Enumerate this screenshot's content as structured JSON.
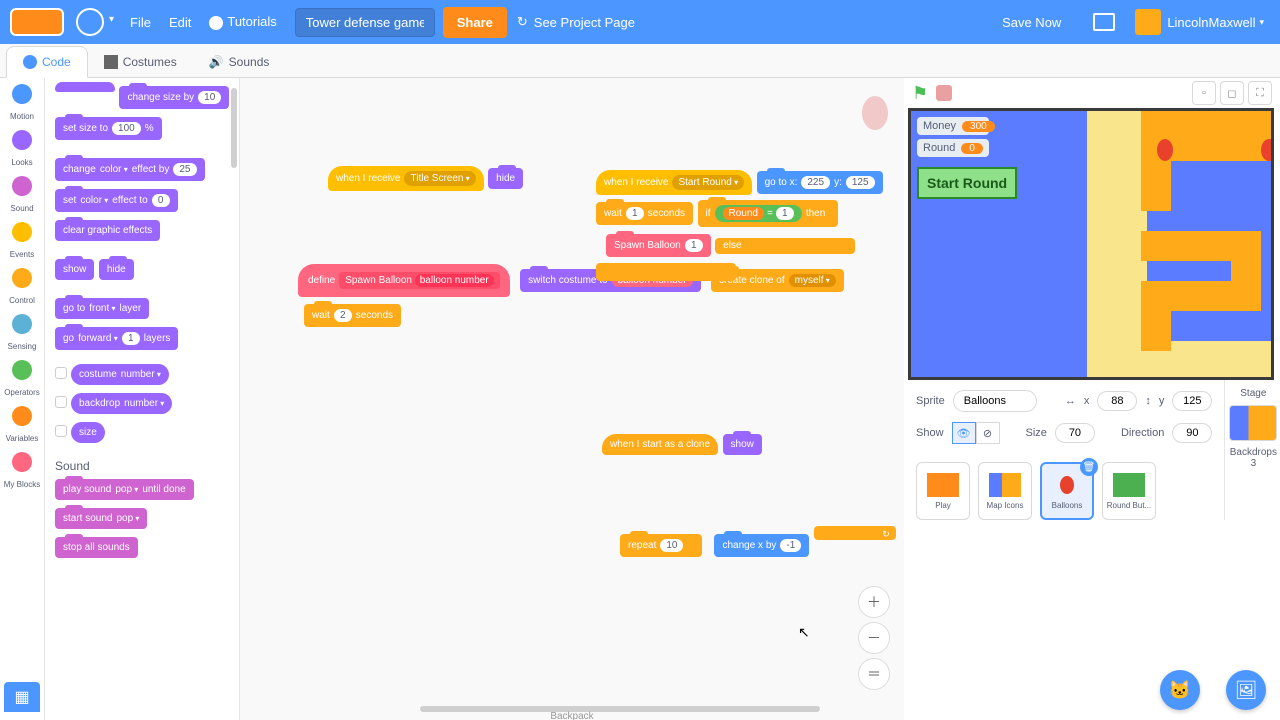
{
  "menu": {
    "file": "File",
    "edit": "Edit",
    "tutorials": "Tutorials",
    "project_title": "Tower defense game",
    "share": "Share",
    "see_project": "See Project Page",
    "save_now": "Save Now",
    "username": "LincolnMaxwell"
  },
  "tabs": {
    "code": "Code",
    "costumes": "Costumes",
    "sounds": "Sounds"
  },
  "categories": {
    "motion": "Motion",
    "looks": "Looks",
    "sound": "Sound",
    "events": "Events",
    "control": "Control",
    "sensing": "Sensing",
    "operators": "Operators",
    "variables": "Variables",
    "myblocks": "My Blocks"
  },
  "palette": {
    "change_size_by": "change size by",
    "change_size_v": "10",
    "set_size_to": "set size to",
    "set_size_v": "100",
    "set_size_pct": "%",
    "change_effect": "change",
    "color": "color",
    "effect_by": "effect by",
    "change_eff_v": "25",
    "set_effect": "set",
    "effect_to": "effect to",
    "set_eff_v": "0",
    "clear_graphic": "clear graphic effects",
    "show": "show",
    "hide": "hide",
    "go_to": "go to",
    "front": "front",
    "layer": "layer",
    "go": "go",
    "forward": "forward",
    "go_v": "1",
    "layers": "layers",
    "costume": "costume",
    "number": "number",
    "backdrop": "backdrop",
    "size": "size",
    "sound_heading": "Sound",
    "play_sound": "play sound",
    "pop": "pop",
    "until_done": "until done",
    "start_sound": "start sound",
    "stop_all": "stop all sounds"
  },
  "scripts": {
    "when_receive": "when I receive",
    "title_screen": "Title Screen",
    "start_round_msg": "Start Round",
    "hide": "hide",
    "show": "show",
    "define": "define",
    "spawn_balloon": "Spawn Balloon",
    "balloon_number": "balloon number",
    "switch_costume": "switch costume to",
    "create_clone": "create clone of",
    "myself": "myself",
    "wait": "wait",
    "wait_v1": "2",
    "wait_v2": "1",
    "seconds": "seconds",
    "goto_xy": "go to x:",
    "gx": "225",
    "gy": "125",
    "y_lbl": "y:",
    "if": "if",
    "then": "then",
    "else": "else",
    "round_var": "Round",
    "eq": "=",
    "eq_v": "1",
    "spawn_arg": "1",
    "when_clone": "when I start as a clone",
    "repeat": "repeat",
    "repeat_v": "10",
    "change_x": "change x by",
    "change_x_v": "-1"
  },
  "stage_hud": {
    "money_lbl": "Money",
    "money_v": "300",
    "round_lbl": "Round",
    "round_v": "0",
    "start_round": "Start Round"
  },
  "sprite_info": {
    "sprite_lbl": "Sprite",
    "name": "Balloons",
    "x_lbl": "x",
    "x_v": "88",
    "y_lbl": "y",
    "y_v": "125",
    "show_lbl": "Show",
    "size_lbl": "Size",
    "size_v": "70",
    "dir_lbl": "Direction",
    "dir_v": "90"
  },
  "sprites": {
    "play": "Play",
    "map_icons": "Map Icons",
    "balloons": "Balloons",
    "round_but": "Round But..."
  },
  "stage_panel": {
    "stage": "Stage",
    "backdrops": "Backdrops",
    "count": "3"
  },
  "backpack": "Backpack"
}
